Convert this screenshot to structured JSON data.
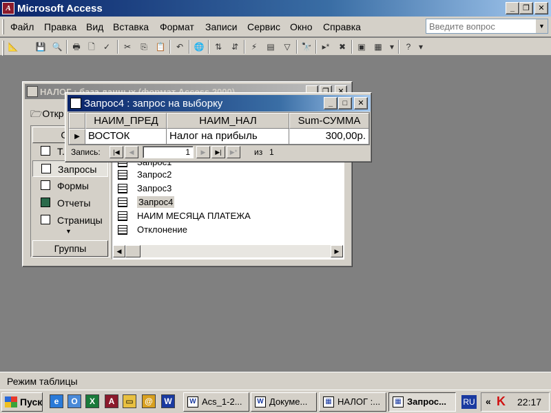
{
  "app": {
    "title": "Microsoft Access",
    "logo": "A"
  },
  "window_controls": {
    "minimize": "_",
    "restore": "❐",
    "close": "✕"
  },
  "menu": {
    "items": [
      "Файл",
      "Правка",
      "Вид",
      "Вставка",
      "Формат",
      "Записи",
      "Сервис",
      "Окно",
      "Справка"
    ],
    "help_placeholder": "Введите вопрос"
  },
  "db_window": {
    "title": "НАЛОГ : база данных (формат Access 2000)",
    "open_label": "Откр",
    "objects_header": "Объ",
    "groups_header": "Группы",
    "sidebar": [
      {
        "label": "Т..."
      },
      {
        "label": "Запросы",
        "selected": true
      },
      {
        "label": "Формы"
      },
      {
        "label": "Отчеты"
      },
      {
        "label": "Страницы"
      }
    ],
    "list": [
      "Запрос1",
      "Запрос2",
      "Запрос3",
      "Запрос4",
      "НАИМ МЕСЯЦА ПЛАТЕЖА",
      "Отклонение"
    ],
    "selected_item": "Запрос4"
  },
  "query_window": {
    "title": "Запрос4 : запрос на выборку",
    "columns": [
      "НАИМ_ПРЕД",
      "НАИМ_НАЛ",
      "Sum-СУММА"
    ],
    "rows": [
      [
        "ВОСТОК",
        "Налог на прибыль",
        "300,00р."
      ]
    ],
    "nav": {
      "record_label": "Запись:",
      "current": "1",
      "of_label": "из",
      "total": "1"
    }
  },
  "status_bar": {
    "text": "Режим таблицы"
  },
  "taskbar": {
    "start_label": "Пуск",
    "tasks": [
      {
        "label": "Acs_1-2...",
        "icon": "W"
      },
      {
        "label": "Докуме...",
        "icon": "W"
      },
      {
        "label": "НАЛОГ :...",
        "icon": "▦"
      },
      {
        "label": "Запрос...",
        "icon": "▦",
        "active": true
      }
    ],
    "lang": "RU",
    "tray_arrow": "«",
    "clock": "22:17"
  }
}
